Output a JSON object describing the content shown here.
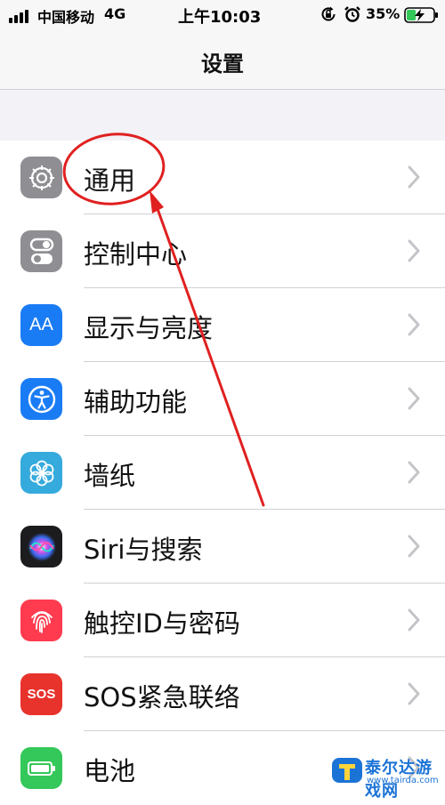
{
  "status_bar": {
    "carrier": "中国移动",
    "network": "4G",
    "time": "上午10:03",
    "battery_percent": "35%",
    "battery_level": 0.35,
    "icons": [
      "signal-icon",
      "orientation-lock-icon",
      "alarm-icon",
      "battery-charging-icon"
    ]
  },
  "nav": {
    "title": "设置"
  },
  "settings": {
    "items": [
      {
        "label": "通用",
        "icon": "gear-icon",
        "color": "#8e8e93"
      },
      {
        "label": "控制中心",
        "icon": "toggles-icon",
        "color": "#8e8e93"
      },
      {
        "label": "显示与亮度",
        "icon": "text-size-icon",
        "color": "#1a7cf5"
      },
      {
        "label": "辅助功能",
        "icon": "accessibility-icon",
        "color": "#1a7cf5"
      },
      {
        "label": "墙纸",
        "icon": "flower-icon",
        "color": "#35aadc"
      },
      {
        "label": "Siri与搜索",
        "icon": "siri-icon",
        "color": "#1c1c1e"
      },
      {
        "label": "触控ID与密码",
        "icon": "fingerprint-icon",
        "color": "#ff3b4f"
      },
      {
        "label": "SOS紧急联络",
        "icon": "sos-icon",
        "color": "#e8322c"
      },
      {
        "label": "电池",
        "icon": "battery-icon",
        "color": "#34c759"
      }
    ]
  },
  "icon_text": {
    "display": "AA",
    "sos": "SOS"
  },
  "annotation": {
    "color": "#e02020"
  },
  "watermark": {
    "text": "泰尔达游戏网",
    "url": "www.tairda.com"
  }
}
